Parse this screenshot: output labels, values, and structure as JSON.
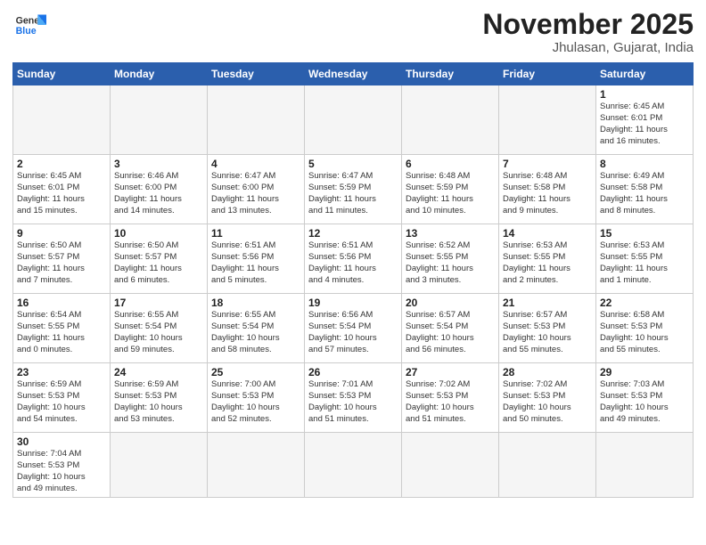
{
  "logo": {
    "text_general": "General",
    "text_blue": "Blue"
  },
  "title": "November 2025",
  "subtitle": "Jhulasan, Gujarat, India",
  "weekdays": [
    "Sunday",
    "Monday",
    "Tuesday",
    "Wednesday",
    "Thursday",
    "Friday",
    "Saturday"
  ],
  "weeks": [
    [
      {
        "day": "",
        "info": ""
      },
      {
        "day": "",
        "info": ""
      },
      {
        "day": "",
        "info": ""
      },
      {
        "day": "",
        "info": ""
      },
      {
        "day": "",
        "info": ""
      },
      {
        "day": "",
        "info": ""
      },
      {
        "day": "1",
        "info": "Sunrise: 6:45 AM\nSunset: 6:01 PM\nDaylight: 11 hours\nand 16 minutes."
      }
    ],
    [
      {
        "day": "2",
        "info": "Sunrise: 6:45 AM\nSunset: 6:01 PM\nDaylight: 11 hours\nand 15 minutes."
      },
      {
        "day": "3",
        "info": "Sunrise: 6:46 AM\nSunset: 6:00 PM\nDaylight: 11 hours\nand 14 minutes."
      },
      {
        "day": "4",
        "info": "Sunrise: 6:47 AM\nSunset: 6:00 PM\nDaylight: 11 hours\nand 13 minutes."
      },
      {
        "day": "5",
        "info": "Sunrise: 6:47 AM\nSunset: 5:59 PM\nDaylight: 11 hours\nand 11 minutes."
      },
      {
        "day": "6",
        "info": "Sunrise: 6:48 AM\nSunset: 5:59 PM\nDaylight: 11 hours\nand 10 minutes."
      },
      {
        "day": "7",
        "info": "Sunrise: 6:48 AM\nSunset: 5:58 PM\nDaylight: 11 hours\nand 9 minutes."
      },
      {
        "day": "8",
        "info": "Sunrise: 6:49 AM\nSunset: 5:58 PM\nDaylight: 11 hours\nand 8 minutes."
      }
    ],
    [
      {
        "day": "9",
        "info": "Sunrise: 6:50 AM\nSunset: 5:57 PM\nDaylight: 11 hours\nand 7 minutes."
      },
      {
        "day": "10",
        "info": "Sunrise: 6:50 AM\nSunset: 5:57 PM\nDaylight: 11 hours\nand 6 minutes."
      },
      {
        "day": "11",
        "info": "Sunrise: 6:51 AM\nSunset: 5:56 PM\nDaylight: 11 hours\nand 5 minutes."
      },
      {
        "day": "12",
        "info": "Sunrise: 6:51 AM\nSunset: 5:56 PM\nDaylight: 11 hours\nand 4 minutes."
      },
      {
        "day": "13",
        "info": "Sunrise: 6:52 AM\nSunset: 5:55 PM\nDaylight: 11 hours\nand 3 minutes."
      },
      {
        "day": "14",
        "info": "Sunrise: 6:53 AM\nSunset: 5:55 PM\nDaylight: 11 hours\nand 2 minutes."
      },
      {
        "day": "15",
        "info": "Sunrise: 6:53 AM\nSunset: 5:55 PM\nDaylight: 11 hours\nand 1 minute."
      }
    ],
    [
      {
        "day": "16",
        "info": "Sunrise: 6:54 AM\nSunset: 5:55 PM\nDaylight: 11 hours\nand 0 minutes."
      },
      {
        "day": "17",
        "info": "Sunrise: 6:55 AM\nSunset: 5:54 PM\nDaylight: 10 hours\nand 59 minutes."
      },
      {
        "day": "18",
        "info": "Sunrise: 6:55 AM\nSunset: 5:54 PM\nDaylight: 10 hours\nand 58 minutes."
      },
      {
        "day": "19",
        "info": "Sunrise: 6:56 AM\nSunset: 5:54 PM\nDaylight: 10 hours\nand 57 minutes."
      },
      {
        "day": "20",
        "info": "Sunrise: 6:57 AM\nSunset: 5:54 PM\nDaylight: 10 hours\nand 56 minutes."
      },
      {
        "day": "21",
        "info": "Sunrise: 6:57 AM\nSunset: 5:53 PM\nDaylight: 10 hours\nand 55 minutes."
      },
      {
        "day": "22",
        "info": "Sunrise: 6:58 AM\nSunset: 5:53 PM\nDaylight: 10 hours\nand 55 minutes."
      }
    ],
    [
      {
        "day": "23",
        "info": "Sunrise: 6:59 AM\nSunset: 5:53 PM\nDaylight: 10 hours\nand 54 minutes."
      },
      {
        "day": "24",
        "info": "Sunrise: 6:59 AM\nSunset: 5:53 PM\nDaylight: 10 hours\nand 53 minutes."
      },
      {
        "day": "25",
        "info": "Sunrise: 7:00 AM\nSunset: 5:53 PM\nDaylight: 10 hours\nand 52 minutes."
      },
      {
        "day": "26",
        "info": "Sunrise: 7:01 AM\nSunset: 5:53 PM\nDaylight: 10 hours\nand 51 minutes."
      },
      {
        "day": "27",
        "info": "Sunrise: 7:02 AM\nSunset: 5:53 PM\nDaylight: 10 hours\nand 51 minutes."
      },
      {
        "day": "28",
        "info": "Sunrise: 7:02 AM\nSunset: 5:53 PM\nDaylight: 10 hours\nand 50 minutes."
      },
      {
        "day": "29",
        "info": "Sunrise: 7:03 AM\nSunset: 5:53 PM\nDaylight: 10 hours\nand 49 minutes."
      }
    ],
    [
      {
        "day": "30",
        "info": "Sunrise: 7:04 AM\nSunset: 5:53 PM\nDaylight: 10 hours\nand 49 minutes."
      },
      {
        "day": "",
        "info": ""
      },
      {
        "day": "",
        "info": ""
      },
      {
        "day": "",
        "info": ""
      },
      {
        "day": "",
        "info": ""
      },
      {
        "day": "",
        "info": ""
      },
      {
        "day": "",
        "info": ""
      }
    ]
  ]
}
